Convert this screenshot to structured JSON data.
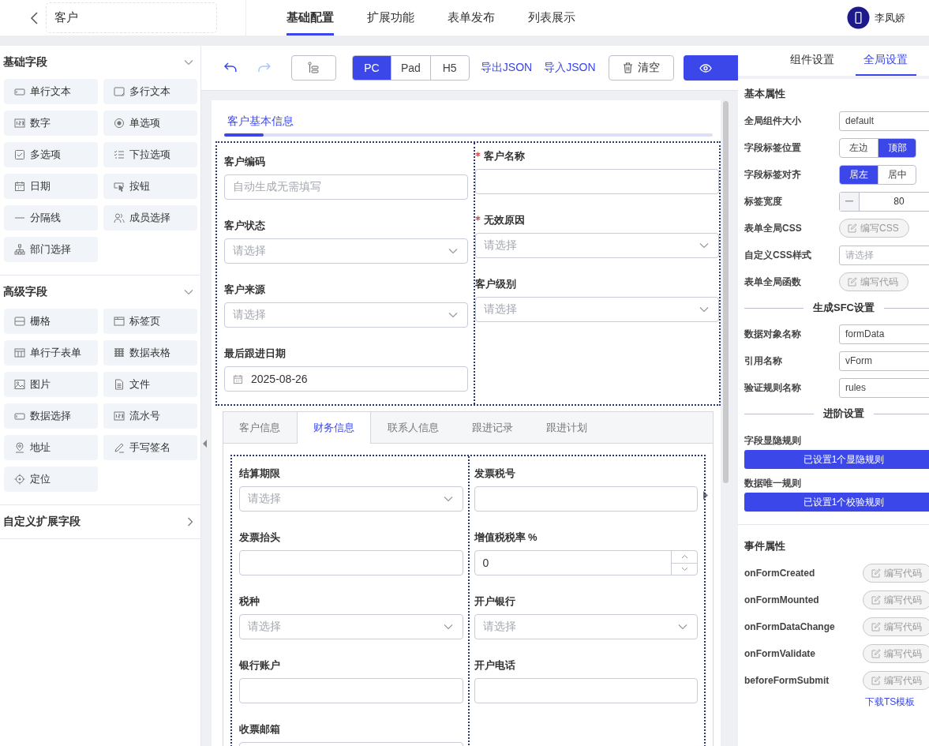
{
  "header": {
    "title": "客户",
    "nav": [
      {
        "label": "基础配置",
        "selected": true
      },
      {
        "label": "扩展功能",
        "selected": false
      },
      {
        "label": "表单发布",
        "selected": false
      },
      {
        "label": "列表展示",
        "selected": false
      }
    ],
    "user": {
      "name": "李凤娇"
    }
  },
  "palette": [
    {
      "title": "基础字段",
      "expanded": true,
      "items": [
        {
          "label": "单行文本",
          "kind": "text"
        },
        {
          "label": "多行文本",
          "kind": "textarea"
        },
        {
          "label": "数字",
          "kind": "number"
        },
        {
          "label": "单选项",
          "kind": "radio"
        },
        {
          "label": "多选项",
          "kind": "checkbox"
        },
        {
          "label": "下拉选项",
          "kind": "dropdown"
        },
        {
          "label": "日期",
          "kind": "date"
        },
        {
          "label": "按钮",
          "kind": "button"
        },
        {
          "label": "分隔线",
          "kind": "divider"
        },
        {
          "label": "成员选择",
          "kind": "member"
        },
        {
          "label": "部门选择",
          "kind": "department"
        }
      ]
    },
    {
      "title": "高级字段",
      "expanded": true,
      "items": [
        {
          "label": "栅格",
          "kind": "grid"
        },
        {
          "label": "标签页",
          "kind": "tabs"
        },
        {
          "label": "单行子表单",
          "kind": "subform"
        },
        {
          "label": "数据表格",
          "kind": "datatable"
        },
        {
          "label": "图片",
          "kind": "image"
        },
        {
          "label": "文件",
          "kind": "file"
        },
        {
          "label": "数据选择",
          "kind": "text"
        },
        {
          "label": "流水号",
          "kind": "number"
        },
        {
          "label": "地址",
          "kind": "address"
        },
        {
          "label": "手写签名",
          "kind": "signature"
        },
        {
          "label": "定位",
          "kind": "location"
        }
      ]
    },
    {
      "title": "自定义扩展字段",
      "expanded": false
    }
  ],
  "toolbar": {
    "history": [
      {
        "kind": "undo",
        "disabled": false
      },
      {
        "kind": "redo",
        "disabled": true
      }
    ],
    "devices": [
      {
        "label": "PC",
        "selected": true
      },
      {
        "label": "Pad",
        "selected": false
      },
      {
        "label": "H5",
        "selected": false
      }
    ],
    "links": [
      "导出JSON",
      "导入JSON"
    ],
    "clear": "清空"
  },
  "form": {
    "section_title": "客户基本信息",
    "columns": [
      [
        {
          "label": "客户编码",
          "required": false,
          "kind": "input",
          "placeholder": "自动生成无需填写"
        },
        {
          "label": "客户状态",
          "required": false,
          "kind": "select",
          "placeholder": "请选择"
        },
        {
          "label": "客户来源",
          "required": false,
          "kind": "select",
          "placeholder": "请选择"
        },
        {
          "label": "最后跟进日期",
          "required": false,
          "kind": "date",
          "value": "2025-08-26"
        }
      ],
      [
        {
          "label": "客户名称",
          "required": true,
          "kind": "input"
        },
        {
          "label": "无效原因",
          "required": true,
          "kind": "select",
          "placeholder": "请选择"
        },
        {
          "label": "客户级别",
          "required": false,
          "kind": "select",
          "placeholder": "请选择"
        }
      ]
    ],
    "tabs": [
      {
        "label": "客户信息",
        "selected": false
      },
      {
        "label": "财务信息",
        "selected": true
      },
      {
        "label": "联系人信息",
        "selected": false
      },
      {
        "label": "跟进记录",
        "selected": false
      },
      {
        "label": "跟进计划",
        "selected": false
      }
    ],
    "tab_columns": [
      [
        {
          "label": "结算期限",
          "required": false,
          "kind": "select",
          "placeholder": "请选择"
        },
        {
          "label": "发票抬头",
          "required": false,
          "kind": "input"
        },
        {
          "label": "税种",
          "required": false,
          "kind": "select",
          "placeholder": "请选择"
        },
        {
          "label": "银行账户",
          "required": false,
          "kind": "input"
        },
        {
          "label": "收票邮箱",
          "required": false,
          "kind": "input"
        }
      ],
      [
        {
          "label": "发票税号",
          "required": false,
          "kind": "input"
        },
        {
          "label": "增值税税率 %",
          "required": false,
          "kind": "number",
          "value": "0"
        },
        {
          "label": "开户银行",
          "required": false,
          "kind": "select",
          "placeholder": "请选择"
        },
        {
          "label": "开户电话",
          "required": false,
          "kind": "input"
        }
      ]
    ]
  },
  "settings": {
    "tabs": [
      {
        "label": "组件设置",
        "selected": false
      },
      {
        "label": "全局设置",
        "selected": true
      }
    ],
    "sections": [
      {
        "kind": "titled",
        "title": "基本属性",
        "rows": [
          {
            "kind": "input",
            "label": "全局组件大小",
            "value": "default"
          },
          {
            "kind": "segment",
            "label": "字段标签位置",
            "options": [
              {
                "label": "左边",
                "selected": false
              },
              {
                "label": "顶部",
                "selected": true
              }
            ]
          },
          {
            "kind": "segment",
            "label": "字段标签对齐",
            "options": [
              {
                "label": "居左",
                "selected": true
              },
              {
                "label": "居中",
                "selected": false
              }
            ]
          },
          {
            "kind": "stepper",
            "label": "标签宽度",
            "value": "80"
          },
          {
            "kind": "code",
            "label": "表单全局CSS",
            "button": "编写CSS"
          },
          {
            "kind": "select",
            "label": "自定义CSS样式",
            "placeholder": "请选择"
          },
          {
            "kind": "code",
            "label": "表单全局函数",
            "button": "编写代码"
          }
        ]
      },
      {
        "kind": "divider",
        "title": "生成SFC设置",
        "rows": [
          {
            "kind": "input",
            "label": "数据对象名称",
            "value": "formData"
          },
          {
            "kind": "input",
            "label": "引用名称",
            "value": "vForm"
          },
          {
            "kind": "input",
            "label": "验证规则名称",
            "value": "rules"
          }
        ]
      },
      {
        "kind": "divider",
        "title": "进阶设置",
        "rows": [
          {
            "kind": "rule",
            "label": "字段显隐规则",
            "button": "已设置1个显隐规则"
          },
          {
            "kind": "rule",
            "label": "数据唯一规则",
            "button": "已设置1个校验规则"
          }
        ]
      },
      {
        "kind": "events",
        "title": "事件属性",
        "rows": [
          {
            "kind": "code",
            "label": "onFormCreated",
            "button": "编写代码"
          },
          {
            "kind": "code",
            "label": "onFormMounted",
            "button": "编写代码"
          },
          {
            "kind": "code",
            "label": "onFormDataChange",
            "button": "编写代码"
          },
          {
            "kind": "code",
            "label": "onFormValidate",
            "button": "编写代码"
          },
          {
            "kind": "code",
            "label": "beforeFormSubmit",
            "button": "编写代码"
          }
        ],
        "link": "下载TS模板"
      }
    ]
  }
}
